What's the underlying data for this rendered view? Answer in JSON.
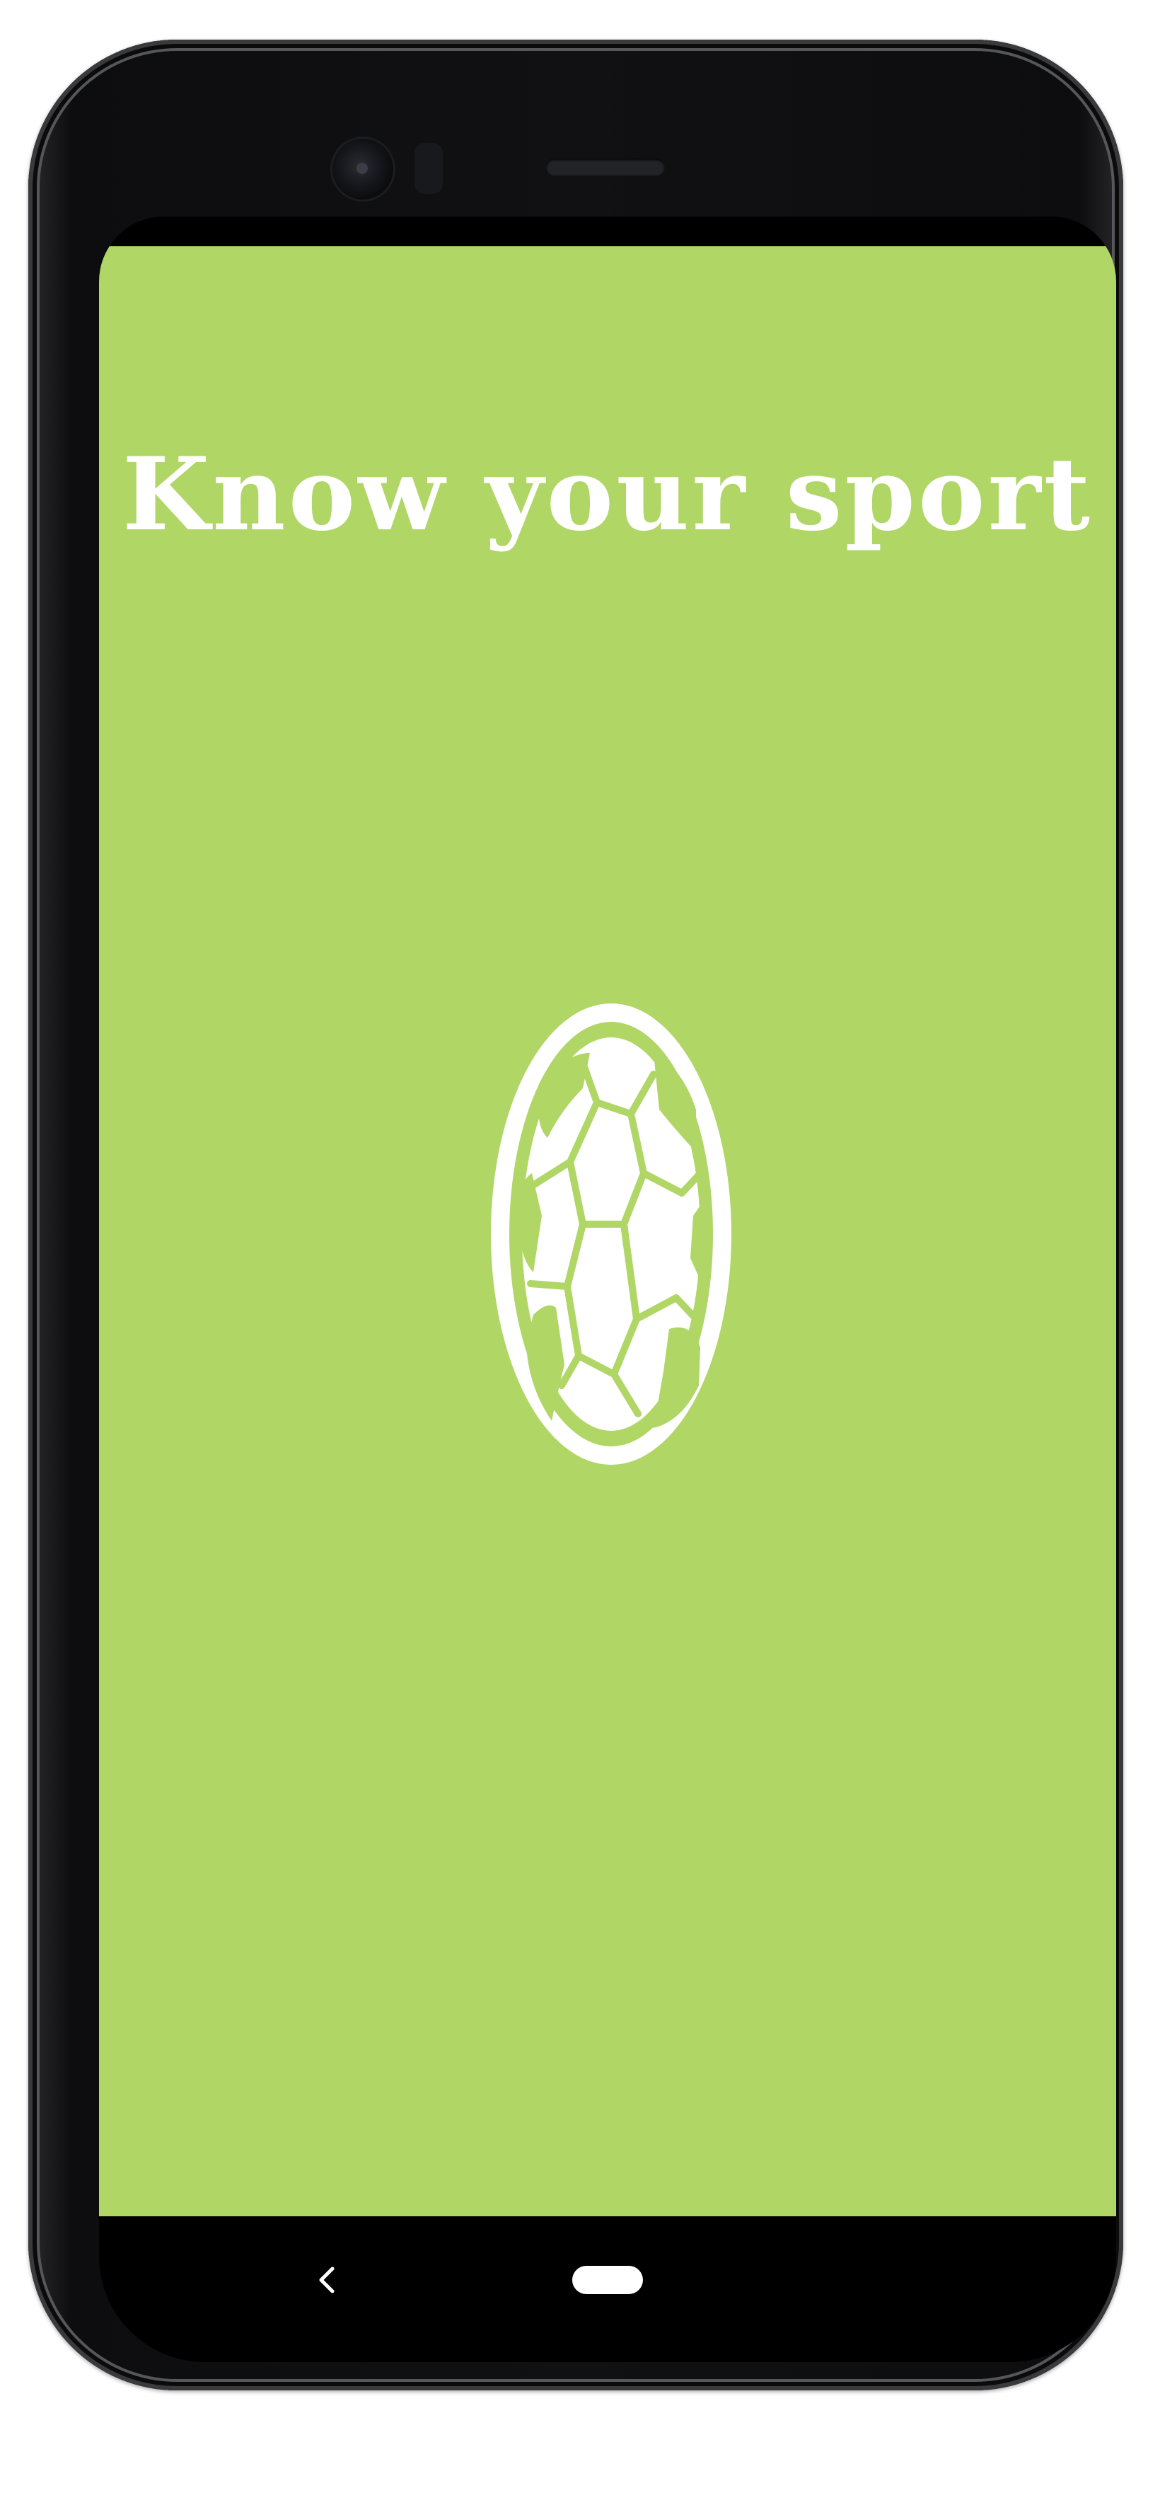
{
  "app": {
    "title": "Know your sport"
  },
  "icons": {
    "main": "soccer-ball-icon",
    "nav_back": "chevron-left-icon",
    "nav_home": "home-pill-icon"
  },
  "colors": {
    "background": "#b0d666",
    "title_text": "#ffffff",
    "icon": "#ffffff",
    "navigation_bar": "#000000"
  }
}
